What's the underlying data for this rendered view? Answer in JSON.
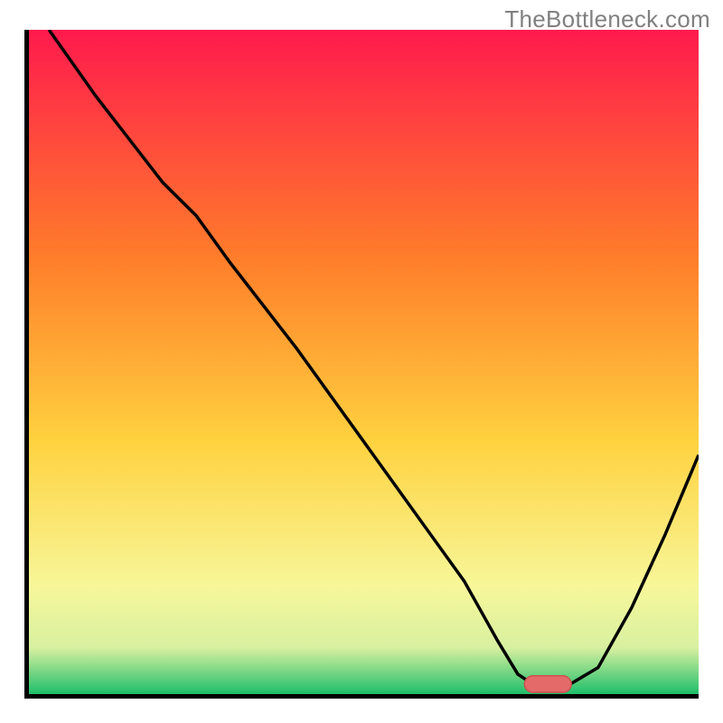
{
  "watermark": "TheBottleneck.com",
  "colors": {
    "gradient_top": "#ff1a4d",
    "gradient_upper_mid": "#ff7f2a",
    "gradient_mid": "#ffd23f",
    "gradient_lower_mid": "#f7f79a",
    "gradient_low": "#d8f0a0",
    "gradient_bottom": "#1fbf6b",
    "axis": "#000000",
    "curve": "#000000",
    "marker_fill": "#e46a6a",
    "marker_stroke": "#d14f4f"
  },
  "chart_data": {
    "type": "line",
    "title": "",
    "xlabel": "",
    "ylabel": "",
    "xlim": [
      0,
      100
    ],
    "ylim": [
      0,
      100
    ],
    "curve": {
      "name": "bottleneck-curve",
      "x": [
        3,
        10,
        20,
        25,
        30,
        40,
        50,
        60,
        65,
        70,
        73,
        76,
        80,
        85,
        90,
        95,
        100
      ],
      "y": [
        100,
        90,
        77,
        72,
        65,
        52,
        38,
        24,
        17,
        8,
        3,
        1,
        1,
        4,
        13,
        24,
        36
      ]
    },
    "marker": {
      "name": "optimal-range",
      "x_start": 74,
      "x_end": 81,
      "y": 1.5,
      "thickness": 2.5
    }
  }
}
